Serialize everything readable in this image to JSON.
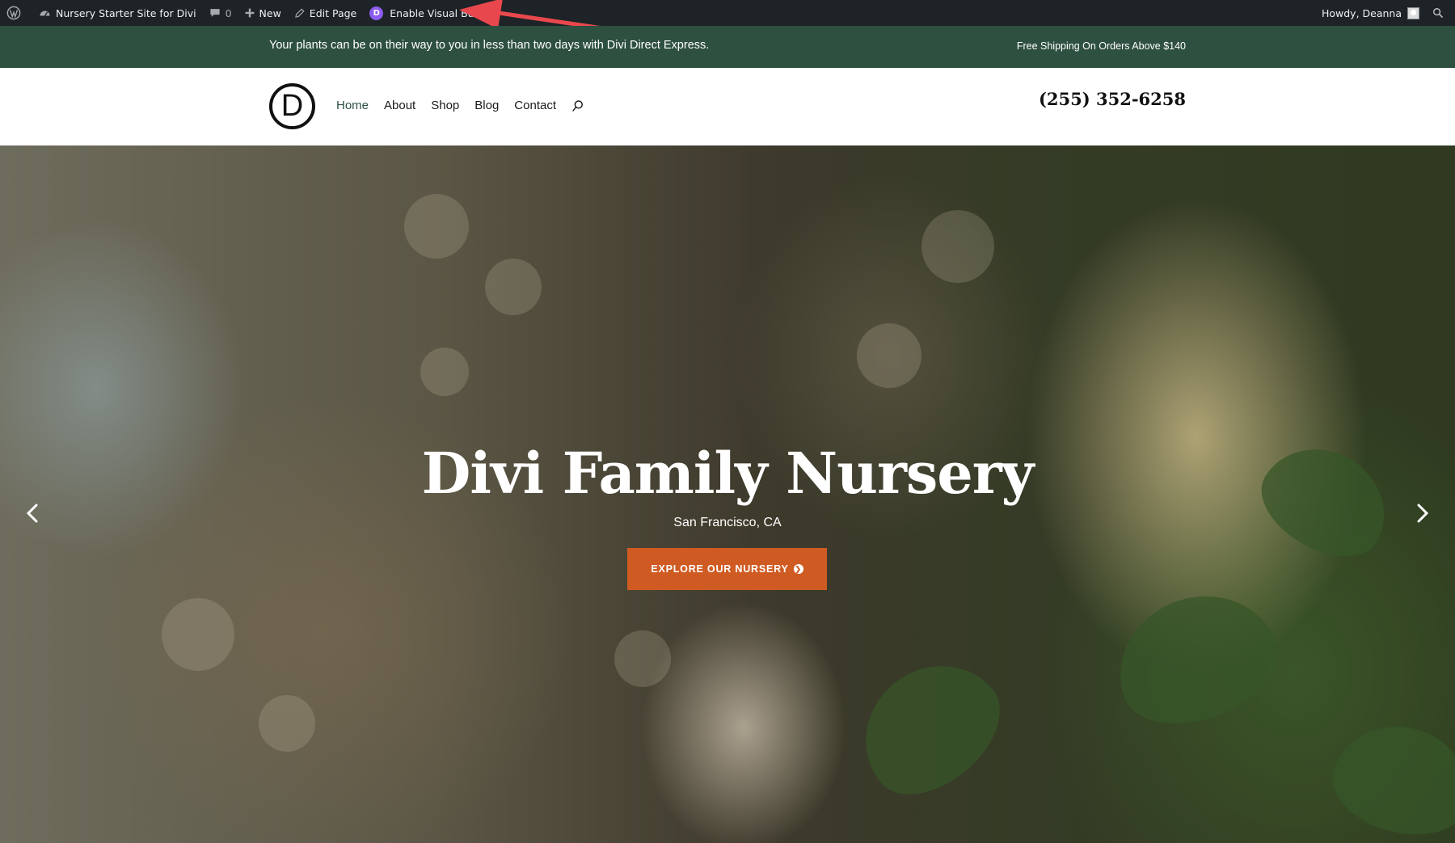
{
  "admin_bar": {
    "site_name": "Nursery Starter Site for Divi",
    "comments_count": "0",
    "new_label": "New",
    "edit_page_label": "Edit Page",
    "visual_builder_label": "Enable Visual Builder",
    "divi_badge": "D",
    "greeting": "Howdy, Deanna"
  },
  "notice_bar": {
    "promo_text": "Your plants can be on their way to you in less than two days with Divi Direct Express.",
    "shipping_text": "Free Shipping On Orders Above $140"
  },
  "header": {
    "logo_letter": "D",
    "nav": [
      {
        "label": "Home",
        "active": true
      },
      {
        "label": "About"
      },
      {
        "label": "Shop"
      },
      {
        "label": "Blog"
      },
      {
        "label": "Contact"
      }
    ],
    "phone": "(255) 352-6258"
  },
  "hero": {
    "title": "Divi Family Nursery",
    "subtitle": "San Francisco, CA",
    "button_label": "EXPLORE OUR NURSERY"
  },
  "colors": {
    "admin_bar_bg": "#1d2327",
    "notice_bar_bg": "#2e5040",
    "active_nav": "#2e5040",
    "cta_button": "#cf5b23",
    "annotation_arrow": "#e8484d"
  },
  "icons": {
    "wordpress": "wordpress-logo-icon",
    "dashboard": "dashboard-gauge-icon",
    "comments": "comment-bubble-icon",
    "new": "plus-icon",
    "edit": "pencil-icon",
    "search": "search-icon",
    "prev": "chevron-left-icon",
    "next": "chevron-right-icon"
  }
}
